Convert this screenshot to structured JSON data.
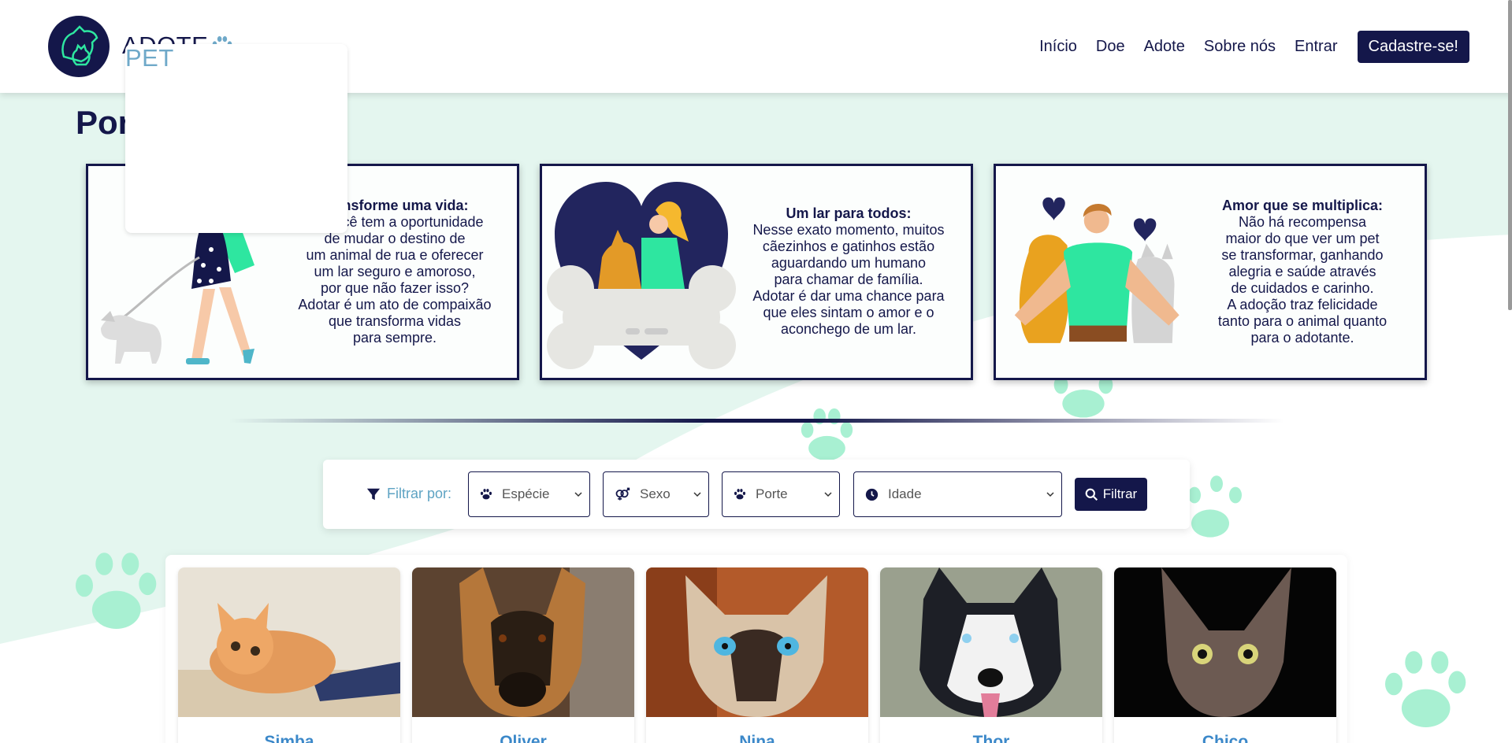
{
  "header": {
    "logo_main": "ADOTE",
    "logo_accent": "PET",
    "nav": {
      "inicio": "Início",
      "doe": "Doe",
      "adote": "Adote",
      "sobre": "Sobre nós",
      "entrar": "Entrar",
      "cadastro": "Cadastre-se!"
    }
  },
  "section": {
    "title": "Por que adotar?"
  },
  "cards": [
    {
      "title": "Transforme uma vida:",
      "body": "Se você tem a oportunidade\nde mudar o destino de\num animal de rua e oferecer\num lar seguro e amoroso,\npor que não fazer isso?\nAdotar é um ato de compaixão\nque transforma vidas\npara sempre."
    },
    {
      "title": "Um lar para todos:",
      "body": "Nesse exato momento, muitos\ncãezinhos e gatinhos estão\naguardando um humano\npara chamar de família.\nAdotar é dar uma chance para\nque eles sintam o amor e o\naconchego de um lar."
    },
    {
      "title": "Amor que se multiplica:",
      "body": "Não há recompensa\nmaior do que ver um pet\nse transformar, ganhando\nalegria e saúde através\nde cuidados e carinho.\nA adoção traz felicidade\ntanto para o animal quanto\npara o adotante."
    }
  ],
  "filter": {
    "label": "Filtrar por:",
    "especie": "Espécie",
    "sexo": "Sexo",
    "porte": "Porte",
    "idade": "Idade",
    "button": "Filtrar"
  },
  "pets": [
    {
      "name": "Simba",
      "icon": "kitten-photo"
    },
    {
      "name": "Oliver",
      "icon": "german-shepherd-photo"
    },
    {
      "name": "Nina",
      "icon": "siamese-cat-photo"
    },
    {
      "name": "Thor",
      "icon": "husky-photo"
    },
    {
      "name": "Chico",
      "icon": "sphynx-cat-photo"
    }
  ],
  "colors": {
    "navy": "#14174a",
    "mint": "#e4f6ef",
    "paw": "#a8f0d2",
    "accent_blue": "#3b88c9"
  }
}
